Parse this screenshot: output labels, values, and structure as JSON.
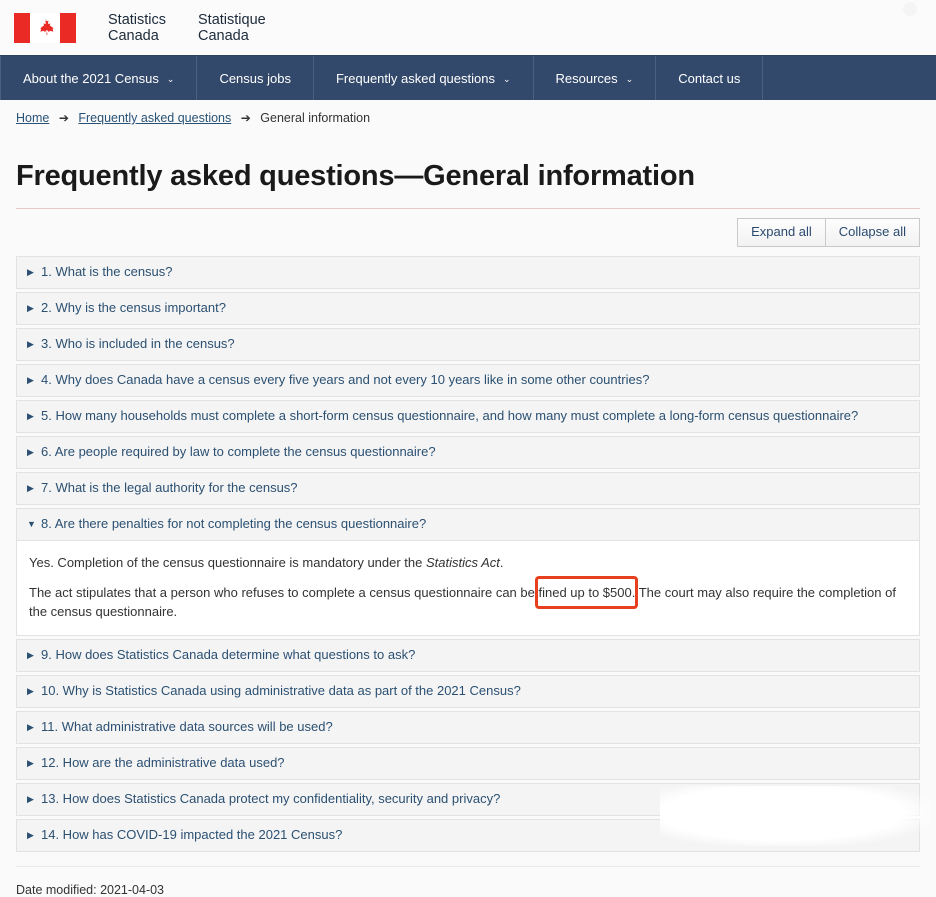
{
  "brand": {
    "flag_alt": "canada-flag",
    "wordmark_en": "Statistics\nCanada",
    "wordmark_fr": "Statistique\nCanada"
  },
  "nav": {
    "items": [
      {
        "label": "About the 2021 Census",
        "has_dropdown": true,
        "caret": "⌄"
      },
      {
        "label": "Census jobs",
        "has_dropdown": false,
        "caret": ""
      },
      {
        "label": "Frequently asked questions",
        "has_dropdown": true,
        "caret": "⌄"
      },
      {
        "label": "Resources",
        "has_dropdown": true,
        "caret": "⌄"
      },
      {
        "label": "Contact us",
        "has_dropdown": false,
        "caret": ""
      }
    ]
  },
  "breadcrumb": {
    "home": "Home",
    "arrow1": "➔",
    "faq": "Frequently asked questions",
    "arrow2": "➔",
    "current": "General information"
  },
  "page": {
    "title": "Frequently asked questions—General information"
  },
  "controls": {
    "expand_all": "Expand all",
    "collapse_all": "Collapse all"
  },
  "markers": {
    "collapsed": "▶",
    "expanded": "▼"
  },
  "accordion": {
    "items": [
      {
        "label": "1. What is the census?",
        "expanded": false
      },
      {
        "label": "2. Why is the census important?",
        "expanded": false
      },
      {
        "label": "3. Who is included in the census?",
        "expanded": false
      },
      {
        "label": "4. Why does Canada have a census every five years and not every 10 years like in some other countries?",
        "expanded": false
      },
      {
        "label": "5. How many households must complete a short-form census questionnaire, and how many must complete a long-form census questionnaire?",
        "expanded": false
      },
      {
        "label": "6. Are people required by law to complete the census questionnaire?",
        "expanded": false
      },
      {
        "label": "7. What is the legal authority for the census?",
        "expanded": false
      },
      {
        "label": "8. Are there penalties for not completing the census questionnaire?",
        "expanded": true,
        "body": {
          "p1_before_italic": "Yes. Completion of the census questionnaire is mandatory under the ",
          "p1_italic": "Statistics Act",
          "p1_after_italic": ".",
          "p2_part1": "The act stipulates that a person who refuses to complete a census questionnaire can be ",
          "p2_highlight": "fined up to $500.",
          "p2_part2": " The court may also require the completion of the census questionnaire."
        }
      },
      {
        "label": "9. How does Statistics Canada determine what questions to ask?",
        "expanded": false
      },
      {
        "label": "10. Why is Statistics Canada using administrative data as part of the 2021 Census?",
        "expanded": false
      },
      {
        "label": "11. What administrative data sources will be used?",
        "expanded": false
      },
      {
        "label": "12. How are the administrative data used?",
        "expanded": false
      },
      {
        "label": "13. How does Statistics Canada protect my confidentiality, security and privacy?",
        "expanded": false
      },
      {
        "label": "14. How has COVID-19 impacted the 2021 Census?",
        "expanded": false
      }
    ]
  },
  "annotation": {
    "highlight_color": "#e8401f",
    "target_text": "fined up to $500."
  },
  "footer": {
    "date_modified": "Date modified: 2021-04-03"
  },
  "colors": {
    "nav_background": "#33496b",
    "link": "#295376",
    "accordion_header_text": "#2b5072",
    "flag_red": "#ea2a24",
    "title_rule": "#e8c9c9"
  }
}
